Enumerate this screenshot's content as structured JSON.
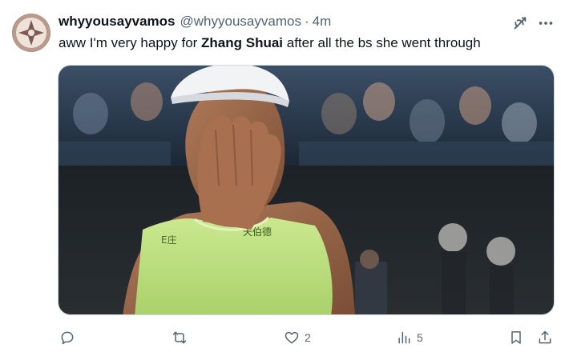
{
  "post": {
    "display_name": "whyyousayvamos",
    "handle": "@whyyousayvamos",
    "separator": "·",
    "time": "4m",
    "text_before": "aww I'm very happy for ",
    "text_bold": "Zhang Shuai",
    "text_after": " after all the bs she went through"
  },
  "media": {
    "jersey_text": "天伯德",
    "jersey_text_left": "E庄"
  },
  "actions": {
    "reply_count": "",
    "repost_count": "",
    "like_count": "2",
    "views_count": "5"
  },
  "icons": {
    "reply": "reply-icon",
    "repost": "repost-icon",
    "like": "heart-icon",
    "views": "views-icon",
    "bookmark": "bookmark-icon",
    "share": "share-icon",
    "grok": "grok-icon",
    "more": "more-icon"
  },
  "colors": {
    "text_primary": "#0f1419",
    "text_secondary": "#536471",
    "divider": "#cfd9de"
  }
}
